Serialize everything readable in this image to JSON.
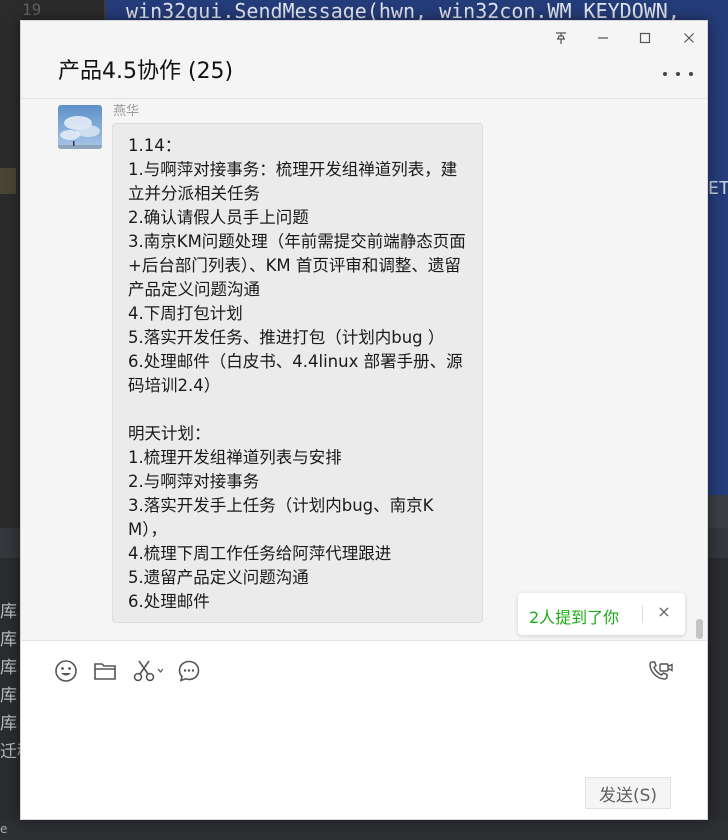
{
  "background": {
    "gutter_line_number": "19",
    "code_line": "win32gui.SendMessage(hwn, win32con.WM_KEYDOWN,",
    "editor_right_text": "ET",
    "terminal_lines": [
      "库",
      "库",
      "库",
      "库",
      "库",
      "迁移"
    ],
    "status_text": "e"
  },
  "chat": {
    "title": "产品4.5协作 (25)",
    "window_controls": {
      "pin": "pin-icon",
      "minimize": "minimize-icon",
      "maximize": "maximize-icon",
      "close": "close-icon"
    },
    "message": {
      "sender": "燕华",
      "text": "1.14：\n1.与啊萍对接事务：梳理开发组禅道列表，建立并分派相关任务\n2.确认请假人员手上问题\n3.南京KM问题处理（年前需提交前端静态页面+后台部门列表）、KM 首页评审和调整、遗留产品定义问题沟通\n4.下周打包计划\n5.落实开发任务、推进打包（计划内bug ）\n6.处理邮件（白皮书、4.4linux 部署手册、源码培训2.4）\n\n明天计划：\n1.梳理开发组禅道列表与安排\n2.与啊萍对接事务\n3.落实开发手上任务（计划内bug、南京KM），\n4.梳理下周工作任务给阿萍代理跟进\n5.遗留产品定义问题沟通\n6.处理邮件"
    },
    "mention_notice": "2人提到了你",
    "mention_close": "×",
    "toolbar": {
      "icons": [
        "emoji-icon",
        "folder-icon",
        "scissors-icon",
        "chat-bubble-icon",
        "video-call-icon"
      ]
    },
    "send_label": "发送(S)"
  },
  "colors": {
    "mention_green": "#1aad19",
    "editor_blue": "#253c7a"
  }
}
